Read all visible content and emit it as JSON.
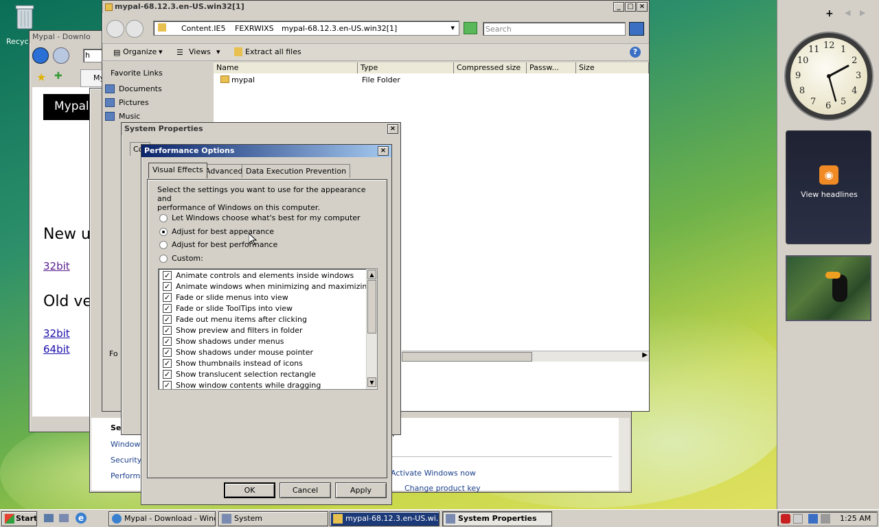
{
  "desktop": {
    "recycle_bin_label": "Recycle"
  },
  "browser": {
    "title": "Mypal - Downlo",
    "address_fragment": "h",
    "tab_label": "My",
    "site_header": "Mypal",
    "heading_new": "New u",
    "link_new_32": "32bit",
    "heading_old": "Old ve",
    "link_old_32": "32bit",
    "link_old_64": "64bit"
  },
  "explorer": {
    "title": "mypal-68.12.3.en-US.win32[1]",
    "breadcrumb": [
      "Content.IE5",
      "FEXRWIXS",
      "mypal-68.12.3.en-US.win32[1]"
    ],
    "search_placeholder": "Search",
    "toolbar": {
      "organize": "Organize",
      "views": "Views",
      "extract": "Extract all files"
    },
    "favorite_links_label": "Favorite Links",
    "nav": [
      "Documents",
      "Pictures",
      "Music"
    ],
    "columns": [
      "Name",
      "Type",
      "Compressed size",
      "Passw...",
      "Size"
    ],
    "rows": [
      {
        "name": "mypal",
        "type": "File Folder"
      }
    ],
    "folders_label": "Fo"
  },
  "system_window": {
    "taskbar_label": "System",
    "sidebar_fragments": [
      "Se",
      "Windows",
      "Security C",
      "Performa"
    ],
    "link_activate": "Activate Windows now",
    "link_change_key": "Change product key",
    "fragment_p": "P"
  },
  "system_properties": {
    "title": "System Properties",
    "tab_fragment": "Co"
  },
  "performance_options": {
    "title": "Performance Options",
    "tabs": [
      "Visual Effects",
      "Advanced",
      "Data Execution Prevention"
    ],
    "description": "Select the settings you want to use for the appearance and performance of Windows on this computer.",
    "description_line1": "Select the settings you want to use for the appearance and",
    "description_line2": "performance of Windows on this computer.",
    "options": [
      {
        "label": "Let Windows choose what's best for my computer",
        "selected": false
      },
      {
        "label": "Adjust for best appearance",
        "selected": true
      },
      {
        "label": "Adjust for best performance",
        "selected": false
      },
      {
        "label": "Custom:",
        "selected": false
      }
    ],
    "effects": [
      {
        "label": "Animate controls and elements inside windows",
        "checked": true
      },
      {
        "label": "Animate windows when minimizing and maximizing",
        "checked": true
      },
      {
        "label": "Fade or slide menus into view",
        "checked": true
      },
      {
        "label": "Fade or slide ToolTips into view",
        "checked": true
      },
      {
        "label": "Fade out menu items after clicking",
        "checked": true
      },
      {
        "label": "Show preview and filters in folder",
        "checked": true
      },
      {
        "label": "Show shadows under menus",
        "checked": true
      },
      {
        "label": "Show shadows under mouse pointer",
        "checked": true
      },
      {
        "label": "Show thumbnails instead of icons",
        "checked": true
      },
      {
        "label": "Show translucent selection rectangle",
        "checked": true
      },
      {
        "label": "Show window contents while dragging",
        "checked": true
      }
    ],
    "buttons": {
      "ok": "OK",
      "cancel": "Cancel",
      "apply": "Apply"
    }
  },
  "taskbar": {
    "start": "Start",
    "items": [
      "Mypal - Download - Wind...",
      "System",
      "mypal-68.12.3.en-US.wi...",
      "System Properties"
    ],
    "time": "1:25 AM"
  },
  "sidebar": {
    "add": "+",
    "clock_numbers": [
      "12",
      "1",
      "2",
      "3",
      "4",
      "5",
      "6",
      "7",
      "8",
      "9",
      "10",
      "11"
    ],
    "feed_label": "View headlines"
  },
  "colors": {
    "title_active": "#0a246a",
    "dialog_bg": "#d4d0c8",
    "link": "#1a0dab"
  }
}
